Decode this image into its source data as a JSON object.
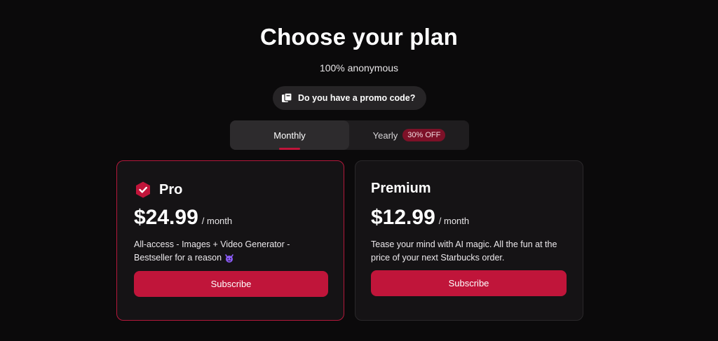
{
  "header": {
    "title": "Choose your plan",
    "subtitle": "100% anonymous"
  },
  "promo": {
    "label": "Do you have a promo code?",
    "icon": "promo-ticket-icon"
  },
  "billing_toggle": {
    "tabs": [
      {
        "label": "Monthly",
        "selected": true
      },
      {
        "label": "Yearly",
        "selected": false,
        "badge": "30% OFF"
      }
    ]
  },
  "plans": [
    {
      "name": "Pro",
      "icon": "shield-check-icon",
      "price": "$24.99",
      "period": "/ month",
      "description": "All-access - Images + Video Generator - Bestseller for a reason",
      "emoji": "devil-face-emoji",
      "button_label": "Subscribe",
      "highlighted": true
    },
    {
      "name": "Premium",
      "price": "$12.99",
      "period": "/ month",
      "description": "Tease your mind with AI magic. All the fun at the price of your next Starbucks order.",
      "button_label": "Subscribe",
      "highlighted": false
    }
  ],
  "colors": {
    "background": "#0b0a0b",
    "accent": "#c0153a",
    "card": "#151315",
    "badge": "#7d1128"
  }
}
